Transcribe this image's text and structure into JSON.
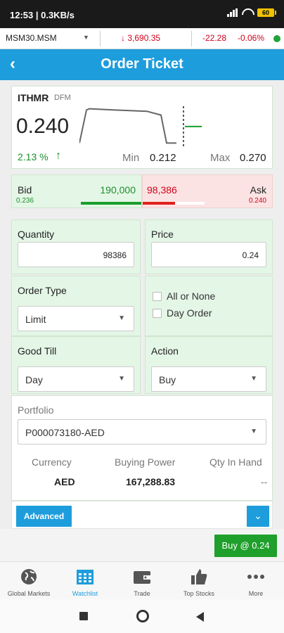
{
  "status_bar": {
    "time": "12:53 | 0.3KB/s",
    "battery": "60"
  },
  "ticker": {
    "index": "MSM30.MSM",
    "value": "3,690.35",
    "change": "-22.28",
    "percent": "-0.06%",
    "arrow": "↓"
  },
  "header": {
    "title": "Order Ticket",
    "back": "‹"
  },
  "quote": {
    "symbol": "ITHMR",
    "exchange": "DFM",
    "last": "0.240",
    "change_pct": "2.13 %",
    "arrow": "🡑",
    "min_label": "Min",
    "min_value": "0.212",
    "max_label": "Max",
    "max_value": "0.270"
  },
  "bid": {
    "label": "Bid",
    "price": "0.236",
    "quantity": "190,000"
  },
  "ask": {
    "label": "Ask",
    "price": "0.240",
    "quantity": "98,386"
  },
  "form": {
    "quantity_label": "Quantity",
    "quantity_value": "98386",
    "price_label": "Price",
    "price_value": "0.24",
    "order_type_label": "Order Type",
    "order_type_value": "Limit",
    "all_or_none_label": "All or None",
    "day_order_label": "Day Order",
    "good_till_label": "Good Till",
    "good_till_value": "Day",
    "action_label": "Action",
    "action_value": "Buy"
  },
  "portfolio": {
    "label": "Portfolio",
    "value": "P000073180-AED",
    "currency_label": "Currency",
    "currency_value": "AED",
    "buying_power_label": "Buying Power",
    "buying_power_value": "167,288.83",
    "qty_in_hand_label": "Qty In Hand",
    "qty_in_hand_value": "--"
  },
  "advanced_label": "Advanced",
  "buy_button": "Buy @ 0.24",
  "nav": [
    {
      "label": "Global Markets",
      "icon": "globe-icon"
    },
    {
      "label": "Watchlist",
      "icon": "calendar-icon",
      "active": true
    },
    {
      "label": "Trade",
      "icon": "wallet-icon"
    },
    {
      "label": "Top Stocks",
      "icon": "thumbs-up-icon"
    },
    {
      "label": "More",
      "icon": "more-icon"
    }
  ],
  "colors": {
    "accent": "#1e9ddc",
    "up": "#1a8f2c",
    "down": "#d0021b",
    "buy": "#1f9f2c"
  },
  "chart_data": {
    "type": "line",
    "note_series": "intraday price sparkline",
    "x": [
      0,
      1,
      2,
      3,
      4,
      5,
      6,
      7
    ],
    "values": [
      0.214,
      0.266,
      0.268,
      0.266,
      0.264,
      0.258,
      0.214,
      0.214
    ],
    "current_marker": 0.24,
    "ylim": [
      0.21,
      0.272
    ]
  }
}
